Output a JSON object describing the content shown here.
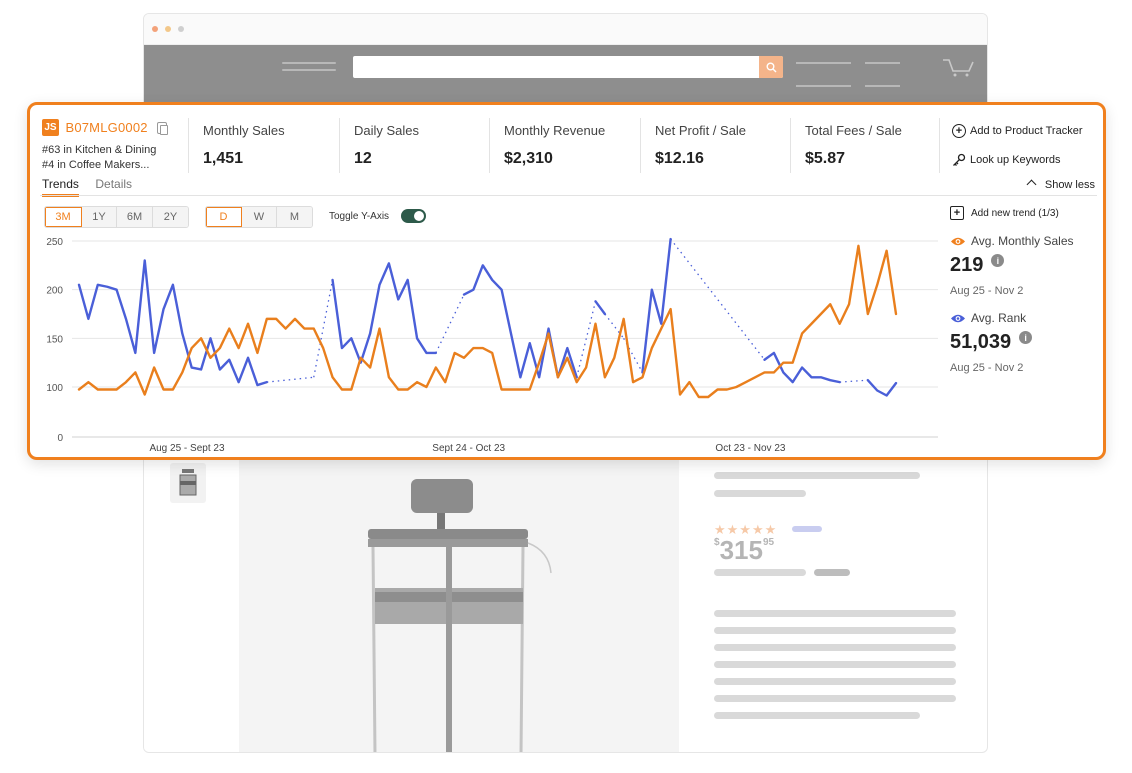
{
  "product": {
    "asin": "B07MLG0002",
    "logo_text": "JS",
    "ranks": [
      "#63 in Kitchen & Dining",
      "#4 in Coffee Makers..."
    ]
  },
  "metrics": [
    {
      "label": "Monthly Sales",
      "value": "1,451"
    },
    {
      "label": "Daily Sales",
      "value": "12"
    },
    {
      "label": "Monthly Revenue",
      "value": "$2,310"
    },
    {
      "label": "Net Profit / Sale",
      "value": "$12.16"
    },
    {
      "label": "Total Fees / Sale",
      "value": "$5.87"
    }
  ],
  "actions": {
    "add_tracker": "Add to Product Tracker",
    "lookup_keywords": "Look up Keywords"
  },
  "tabs": [
    {
      "label": "Trends",
      "active": true
    },
    {
      "label": "Details",
      "active": false
    }
  ],
  "show_less": "Show less",
  "range_buttons": [
    {
      "label": "3M",
      "active": true
    },
    {
      "label": "1Y",
      "active": false
    },
    {
      "label": "6M",
      "active": false
    },
    {
      "label": "2Y",
      "active": false
    }
  ],
  "interval_buttons": [
    {
      "label": "D",
      "active": true
    },
    {
      "label": "W",
      "active": false
    },
    {
      "label": "M",
      "active": false
    }
  ],
  "toggle_y_axis": {
    "label": "Toggle Y-Axis",
    "on": true
  },
  "side": {
    "add_trend": "Add new trend (1/3)",
    "stats": [
      {
        "label": "Avg. Monthly Sales",
        "value": "219",
        "range": "Aug 25 - Nov 2",
        "color": "#f0801e",
        "info": "i"
      },
      {
        "label": "Avg. Rank",
        "value": "51,039",
        "range": "Aug 25 - Nov 2",
        "color": "#4a5fd8",
        "info": "i"
      }
    ]
  },
  "store": {
    "price_currency": "$",
    "price_main": "315",
    "price_cents": "95",
    "stars": "★★★★★"
  },
  "colors": {
    "accent": "#f0801e",
    "rank_line": "#4a5fd8",
    "sales_line": "#e97f1d"
  },
  "chart_data": {
    "type": "line",
    "title": "",
    "xlabel": "",
    "ylabel": "",
    "ylim": [
      0,
      250
    ],
    "yticks": [
      0,
      100,
      150,
      200,
      250
    ],
    "xticks": [
      {
        "label": "Aug 25 - Sept 23",
        "at": 11.5
      },
      {
        "label": "Sept 24 - Oct 23",
        "at": 41.5
      },
      {
        "label": "Oct 23 - Nov 23",
        "at": 71.5
      }
    ],
    "grid": true,
    "series": [
      {
        "color": "#4a5fd8",
        "values": [
          205,
          170,
          205,
          203,
          200,
          170,
          135,
          230,
          135,
          180,
          205,
          155,
          120,
          118,
          150,
          118,
          128,
          105,
          130,
          102,
          105,
          null,
          null,
          null,
          null,
          110,
          null,
          210,
          140,
          150,
          125,
          155,
          205,
          227,
          190,
          210,
          150,
          135,
          135,
          null,
          null,
          195,
          200,
          225,
          210,
          200,
          155,
          110,
          145,
          110,
          160,
          110,
          140,
          110,
          null,
          188,
          175,
          null,
          150,
          null,
          115,
          200,
          165,
          252,
          null,
          null,
          null,
          null,
          null,
          null,
          null,
          null,
          null,
          128,
          135,
          115,
          105,
          120,
          110,
          110,
          107,
          105,
          null,
          null,
          107,
          93,
          83,
          104
        ],
        "style": "solid"
      },
      {
        "color": "#e97f1d",
        "values": [
          95,
          105,
          95,
          95,
          95,
          105,
          115,
          85,
          120,
          95,
          95,
          115,
          140,
          150,
          130,
          140,
          160,
          140,
          165,
          135,
          170,
          170,
          160,
          170,
          160,
          160,
          140,
          110,
          95,
          95,
          130,
          120,
          160,
          110,
          95,
          95,
          105,
          100,
          120,
          105,
          135,
          130,
          140,
          140,
          135,
          95,
          95,
          95,
          95,
          125,
          155,
          110,
          130,
          105,
          120,
          165,
          110,
          130,
          170,
          105,
          110,
          140,
          160,
          180,
          85,
          105,
          80,
          80,
          95,
          95,
          100,
          105,
          110,
          115,
          115,
          125,
          125,
          155,
          165,
          175,
          185,
          165,
          185,
          245,
          175,
          205,
          240,
          175
        ]
      }
    ],
    "dashed_gaps": true
  }
}
